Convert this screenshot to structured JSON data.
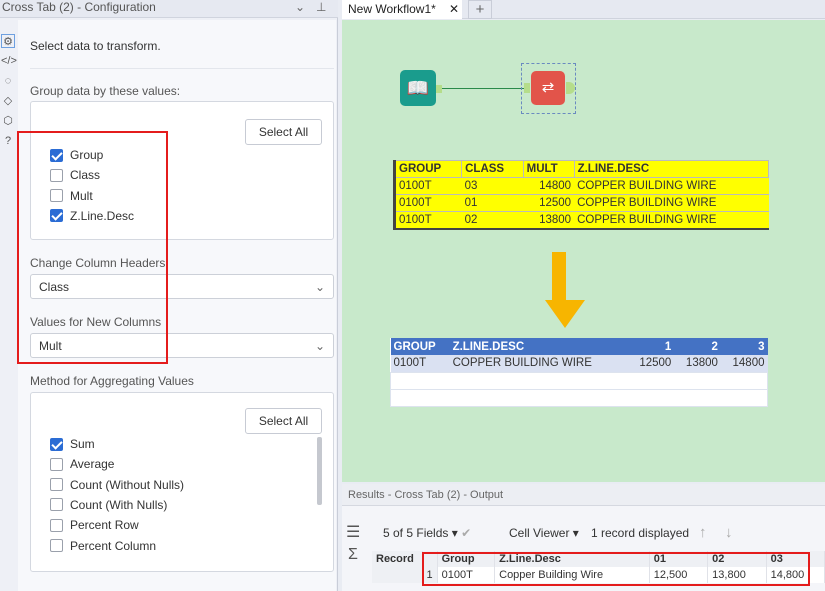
{
  "config": {
    "title": "Cross Tab (2) - Configuration",
    "intro": "Select data to transform.",
    "group_label": "Group data by these values:",
    "select_all": "Select All",
    "group_fields": [
      {
        "label": "Group",
        "checked": true
      },
      {
        "label": "Class",
        "checked": false
      },
      {
        "label": "Mult",
        "checked": false
      },
      {
        "label": "Z.Line.Desc",
        "checked": true
      }
    ],
    "headers_label": "Change Column Headers",
    "headers_value": "Class",
    "values_label": "Values for New Columns",
    "values_value": "Mult",
    "method_label": "Method for Aggregating Values",
    "methods": [
      {
        "label": "Sum",
        "checked": true
      },
      {
        "label": "Average",
        "checked": false
      },
      {
        "label": "Count (Without Nulls)",
        "checked": false
      },
      {
        "label": "Count (With Nulls)",
        "checked": false
      },
      {
        "label": "Percent Row",
        "checked": false
      },
      {
        "label": "Percent Column",
        "checked": false
      }
    ]
  },
  "tabs": {
    "active": "New Workflow1*",
    "add": "+"
  },
  "input_table": {
    "headers": [
      "GROUP",
      "CLASS",
      "MULT",
      "Z.LINE.DESC"
    ],
    "rows": [
      [
        "0100T",
        "03",
        "14800",
        "COPPER BUILDING WIRE"
      ],
      [
        "0100T",
        "01",
        "12500",
        "COPPER BUILDING WIRE"
      ],
      [
        "0100T",
        "02",
        "13800",
        "COPPER BUILDING WIRE"
      ]
    ]
  },
  "output_table": {
    "headers": [
      "GROUP",
      "Z.LINE.DESC",
      "1",
      "2",
      "3"
    ],
    "rows": [
      [
        "0100T",
        "COPPER BUILDING WIRE",
        "12500",
        "13800",
        "14800"
      ]
    ]
  },
  "results": {
    "title": "Results - Cross Tab (2) - Output",
    "fields": "5 of 5 Fields",
    "viewer": "Cell Viewer",
    "records": "1 record displayed",
    "headers": [
      "Record",
      "Group",
      "Z.Line.Desc",
      "01",
      "02",
      "03"
    ],
    "rows": [
      [
        "1",
        "0100T",
        "Copper Building Wire",
        "12,500",
        "13,800",
        "14,800"
      ]
    ]
  },
  "colors": {
    "canvas": "#c8e9cb",
    "yellow": "#ffff00",
    "blue_header": "#4472c4",
    "red_highlight": "#e41c1c"
  }
}
